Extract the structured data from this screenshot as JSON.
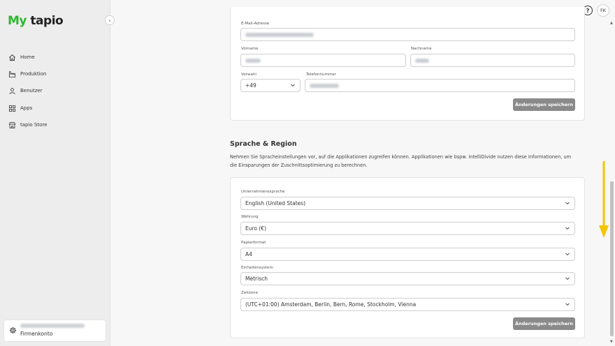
{
  "app": {
    "logo_my": "My",
    "logo_tapio": "tapio"
  },
  "sidebar": {
    "items": [
      {
        "label": "Home",
        "icon": "home-icon"
      },
      {
        "label": "Produktion",
        "icon": "factory-icon"
      },
      {
        "label": "Benutzer",
        "icon": "user-icon"
      },
      {
        "label": "Apps",
        "icon": "apps-grid-icon"
      },
      {
        "label": "tapio Store",
        "icon": "store-icon"
      }
    ],
    "account": {
      "label": "Firmenkonto",
      "icon": "gear-icon"
    }
  },
  "header": {
    "avatar_initials": "FK",
    "help_icon": "?"
  },
  "profile": {
    "email_label": "E-Mail-Adresse",
    "first_name_label": "Vorname",
    "last_name_label": "Nachname",
    "prefix_label": "Vorwahl",
    "prefix_value": "+49",
    "phone_label": "Telefonnummer",
    "save_label": "Änderungen speichern"
  },
  "language_region": {
    "title": "Sprache & Region",
    "description": "Nehmen Sie Spracheinstellungen vor, auf die Applikationen zugreifen können. Applikationen wie bspw. intelliDivide nutzen diese Informationen, um die Einsparungen der Zuschnittsoptimierung zu berechnen.",
    "company_language_label": "Unternehmenssprache",
    "company_language_value": "English (United States)",
    "currency_label": "Währung",
    "currency_value": "Euro (€)",
    "paper_format_label": "Papierformat",
    "paper_format_value": "A4",
    "unit_system_label": "Einheitensystem",
    "unit_system_value": "Metrisch",
    "timezone_label": "Zeitzone",
    "timezone_value": "(UTC+01:00) Amsterdam, Berlin, Bern, Rome, Stockholm, Vienna",
    "save_label": "Änderungen speichern"
  },
  "colors": {
    "brand_green": "#2eb82e",
    "button_gray": "#8a8a8a",
    "annotation_arrow": "#f5c400"
  }
}
